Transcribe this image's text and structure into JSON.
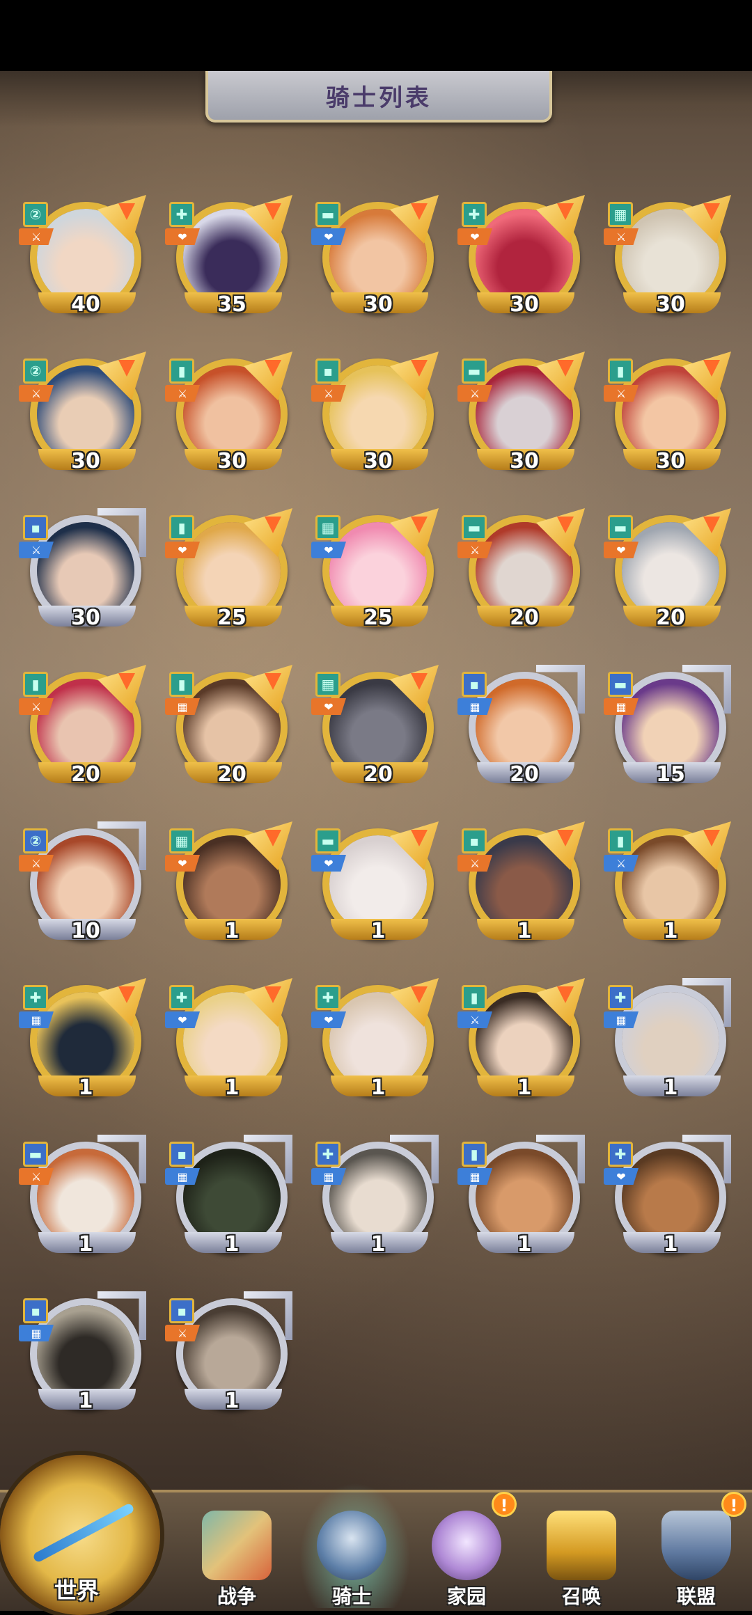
{
  "header": {
    "title": "骑士列表"
  },
  "knights": [
    {
      "level": "40",
      "frame": "gold",
      "class": "cyan",
      "type": "orange",
      "tier": "②",
      "type_glyph": "⚔"
    },
    {
      "level": "35",
      "frame": "gold",
      "class": "cyan",
      "type": "orange",
      "tier": "✚",
      "type_glyph": "❤"
    },
    {
      "level": "30",
      "frame": "gold",
      "class": "cyan",
      "type": "blue",
      "tier": "▬",
      "type_glyph": "❤"
    },
    {
      "level": "30",
      "frame": "gold",
      "class": "cyan",
      "type": "orange",
      "tier": "✚",
      "type_glyph": "❤"
    },
    {
      "level": "30",
      "frame": "gold",
      "class": "cyan",
      "type": "orange",
      "tier": "▦",
      "type_glyph": "⚔"
    },
    {
      "level": "30",
      "frame": "gold",
      "class": "cyan",
      "type": "orange",
      "tier": "②",
      "type_glyph": "⚔"
    },
    {
      "level": "30",
      "frame": "gold",
      "class": "cyan",
      "type": "orange",
      "tier": "▮",
      "type_glyph": "⚔"
    },
    {
      "level": "30",
      "frame": "gold",
      "class": "cyan",
      "type": "orange",
      "tier": "▪",
      "type_glyph": "⚔"
    },
    {
      "level": "30",
      "frame": "gold",
      "class": "cyan",
      "type": "orange",
      "tier": "▬",
      "type_glyph": "⚔"
    },
    {
      "level": "30",
      "frame": "gold",
      "class": "cyan",
      "type": "orange",
      "tier": "▮",
      "type_glyph": "⚔"
    },
    {
      "level": "30",
      "frame": "silver",
      "class": "blue",
      "type": "blue",
      "tier": "▪",
      "type_glyph": "⚔"
    },
    {
      "level": "25",
      "frame": "gold",
      "class": "cyan",
      "type": "orange",
      "tier": "▮",
      "type_glyph": "❤"
    },
    {
      "level": "25",
      "frame": "gold",
      "class": "cyan",
      "type": "blue",
      "tier": "▦",
      "type_glyph": "❤"
    },
    {
      "level": "20",
      "frame": "gold",
      "class": "cyan",
      "type": "orange",
      "tier": "▬",
      "type_glyph": "⚔"
    },
    {
      "level": "20",
      "frame": "gold",
      "class": "cyan",
      "type": "orange",
      "tier": "▬",
      "type_glyph": "❤"
    },
    {
      "level": "20",
      "frame": "gold",
      "class": "cyan",
      "type": "orange",
      "tier": "▮",
      "type_glyph": "⚔"
    },
    {
      "level": "20",
      "frame": "gold",
      "class": "cyan",
      "type": "orange",
      "tier": "▮",
      "type_glyph": "▦"
    },
    {
      "level": "20",
      "frame": "gold",
      "class": "cyan",
      "type": "orange",
      "tier": "▦",
      "type_glyph": "❤"
    },
    {
      "level": "20",
      "frame": "silver",
      "class": "blue",
      "type": "blue",
      "tier": "▪",
      "type_glyph": "▦"
    },
    {
      "level": "15",
      "frame": "silver",
      "class": "blue",
      "type": "orange",
      "tier": "▬",
      "type_glyph": "▦"
    },
    {
      "level": "10",
      "frame": "silver",
      "class": "blue",
      "type": "orange",
      "tier": "②",
      "type_glyph": "⚔"
    },
    {
      "level": "1",
      "frame": "gold",
      "class": "cyan",
      "type": "orange",
      "tier": "▦",
      "type_glyph": "❤"
    },
    {
      "level": "1",
      "frame": "gold",
      "class": "cyan",
      "type": "blue",
      "tier": "▬",
      "type_glyph": "❤"
    },
    {
      "level": "1",
      "frame": "gold",
      "class": "cyan",
      "type": "orange",
      "tier": "▪",
      "type_glyph": "⚔"
    },
    {
      "level": "1",
      "frame": "gold",
      "class": "cyan",
      "type": "blue",
      "tier": "▮",
      "type_glyph": "⚔"
    },
    {
      "level": "1",
      "frame": "gold",
      "class": "cyan",
      "type": "blue",
      "tier": "✚",
      "type_glyph": "▦"
    },
    {
      "level": "1",
      "frame": "gold",
      "class": "cyan",
      "type": "blue",
      "tier": "✚",
      "type_glyph": "❤"
    },
    {
      "level": "1",
      "frame": "gold",
      "class": "cyan",
      "type": "blue",
      "tier": "✚",
      "type_glyph": "❤"
    },
    {
      "level": "1",
      "frame": "gold",
      "class": "cyan",
      "type": "blue",
      "tier": "▮",
      "type_glyph": "⚔"
    },
    {
      "level": "1",
      "frame": "silver",
      "class": "blue",
      "type": "blue",
      "tier": "✚",
      "type_glyph": "▦"
    },
    {
      "level": "1",
      "frame": "silver",
      "class": "blue",
      "type": "orange",
      "tier": "▬",
      "type_glyph": "⚔"
    },
    {
      "level": "1",
      "frame": "silver",
      "class": "blue",
      "type": "blue",
      "tier": "▪",
      "type_glyph": "▦"
    },
    {
      "level": "1",
      "frame": "silver",
      "class": "blue",
      "type": "blue",
      "tier": "✚",
      "type_glyph": "▦"
    },
    {
      "level": "1",
      "frame": "silver",
      "class": "blue",
      "type": "blue",
      "tier": "▮",
      "type_glyph": "▦"
    },
    {
      "level": "1",
      "frame": "silver",
      "class": "blue",
      "type": "blue",
      "tier": "✚",
      "type_glyph": "❤"
    },
    {
      "level": "1",
      "frame": "silver",
      "class": "blue",
      "type": "blue",
      "tier": "▪",
      "type_glyph": "▦"
    },
    {
      "level": "1",
      "frame": "silver",
      "class": "blue",
      "type": "orange",
      "tier": "▪",
      "type_glyph": "⚔"
    }
  ],
  "nav": {
    "world": "世界",
    "war": "战争",
    "knight": "骑士",
    "home": "家园",
    "summon": "召唤",
    "alliance": "联盟",
    "alert_mark": "!"
  },
  "colors": {
    "gold_frame": "#e2b53c",
    "silver_frame": "#c9ccd8",
    "accent_orange": "#e8752a",
    "accent_blue": "#3d7fd9"
  }
}
